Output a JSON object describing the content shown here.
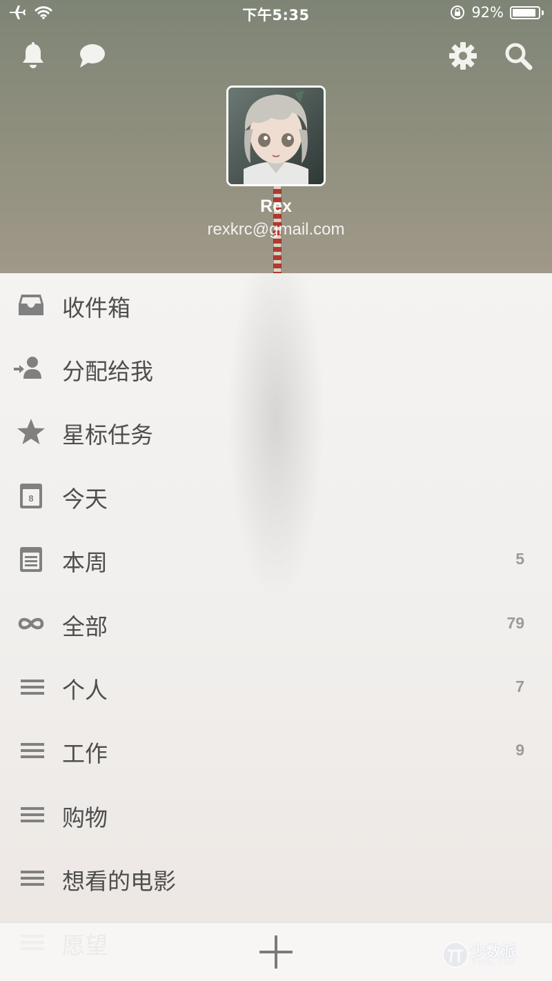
{
  "status_bar": {
    "time": "下午5:35",
    "battery_percent": "92%",
    "battery_level": 0.92,
    "icons": [
      "airplane-mode-icon",
      "wifi-icon",
      "rotation-lock-icon",
      "battery-icon"
    ]
  },
  "header": {
    "icons": [
      "bell-icon",
      "chat-bubble-icon",
      "gear-icon",
      "search-icon"
    ],
    "user": {
      "name": "Rex",
      "email": "rexkrc@gmail.com"
    }
  },
  "menu": {
    "items": [
      {
        "label": "收件箱",
        "count": "",
        "icon": "inbox-icon"
      },
      {
        "label": "分配给我",
        "count": "",
        "icon": "assigned-to-me-icon"
      },
      {
        "label": "星标任务",
        "count": "",
        "icon": "star-icon"
      },
      {
        "label": "今天",
        "count": "",
        "icon": "calendar-day-icon",
        "icon_text": "8"
      },
      {
        "label": "本周",
        "count": "5",
        "icon": "calendar-week-icon"
      },
      {
        "label": "全部",
        "count": "79",
        "icon": "infinity-icon"
      },
      {
        "label": "个人",
        "count": "7",
        "icon": "list-icon"
      },
      {
        "label": "工作",
        "count": "9",
        "icon": "list-icon"
      },
      {
        "label": "购物",
        "count": "",
        "icon": "list-icon"
      },
      {
        "label": "想看的电影",
        "count": "",
        "icon": "list-icon"
      },
      {
        "label": "愿望",
        "count": "",
        "icon": "list-icon"
      }
    ]
  },
  "bottom_bar": {
    "add_icon": "plus-icon",
    "watermark_text": "少数派",
    "watermark_sub": "SSPAI.COM"
  },
  "colors": {
    "menu_text": "#4e4e4e",
    "menu_icon": "#808080",
    "count_text": "#9b9b9b"
  }
}
